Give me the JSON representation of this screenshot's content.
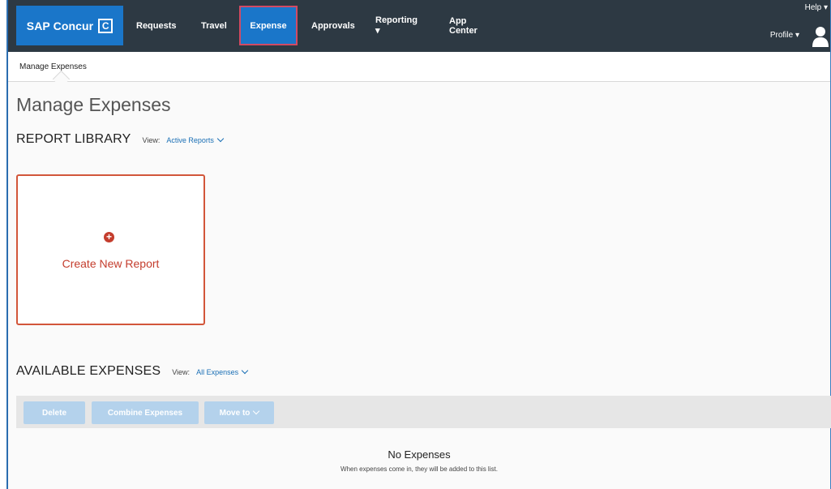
{
  "header": {
    "brand": "SAP Concur",
    "brand_mark": "C",
    "nav": [
      {
        "label": "Requests"
      },
      {
        "label": "Travel"
      },
      {
        "label": "Expense",
        "active": true
      },
      {
        "label": "Approvals"
      },
      {
        "label": "Reporting ▾"
      },
      {
        "label": "App Center"
      }
    ],
    "help": "Help ▾",
    "profile": "Profile ▾",
    "avatar_icon": "user-icon"
  },
  "subnav": {
    "breadcrumb": "Manage Expenses"
  },
  "page": {
    "title": "Manage Expenses"
  },
  "report_library": {
    "title": "REPORT LIBRARY",
    "view_label": "View:",
    "view_value": "Active Reports",
    "create_icon": "plus-circle-icon",
    "create_label": "Create New Report"
  },
  "available_expenses": {
    "title": "AVAILABLE EXPENSES",
    "view_label": "View:",
    "view_value": "All Expenses",
    "buttons": {
      "delete": "Delete",
      "combine": "Combine Expenses",
      "move": "Move to"
    },
    "empty_title": "No Expenses",
    "empty_subtitle": "When expenses come in, they will be added to this list."
  },
  "colors": {
    "topbar": "#2d3943",
    "brand_blue": "#1a76c9",
    "accent_red": "#c43d2d",
    "link_blue": "#1a6fb5",
    "disabled_button": "#b4d2ec"
  }
}
